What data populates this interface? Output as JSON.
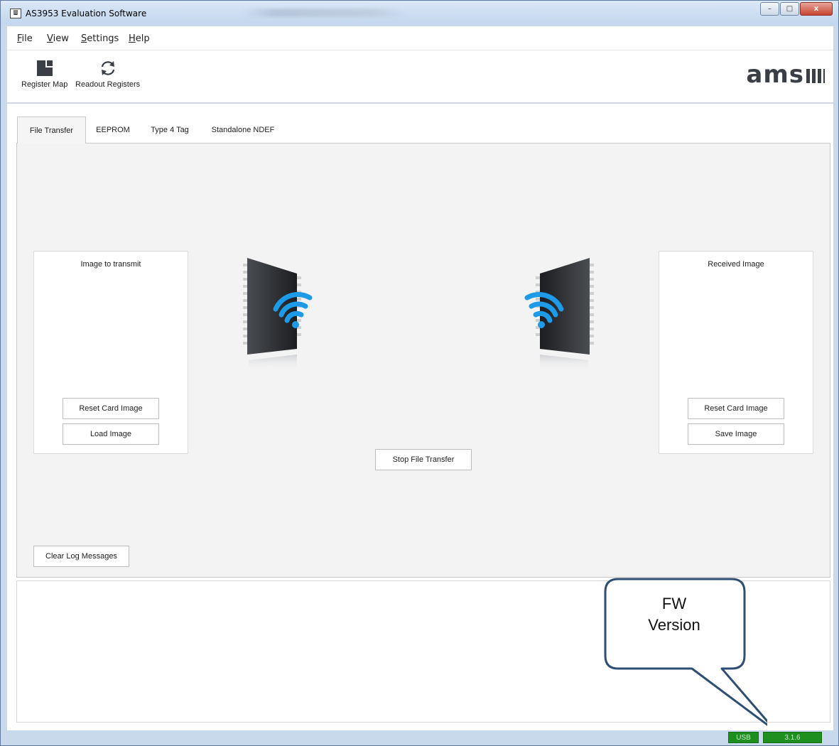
{
  "window": {
    "title": "AS3953 Evaluation Software",
    "app_icon": "ams-icon",
    "controls": {
      "minimize": "–",
      "maximize": "□",
      "close": "x"
    }
  },
  "menu": {
    "items": [
      {
        "label": "File"
      },
      {
        "label": "View"
      },
      {
        "label": "Settings"
      },
      {
        "label": "Help"
      }
    ]
  },
  "toolbar": {
    "register_map_label": "Register Map",
    "register_map_icon": "register-map-icon",
    "readout_registers_label": "Readout Registers",
    "readout_registers_icon": "refresh-icon",
    "logo_text": "ams"
  },
  "tabs": [
    {
      "label": "File Transfer",
      "active": true
    },
    {
      "label": "EEPROM",
      "active": false
    },
    {
      "label": "Type 4 Tag",
      "active": false
    },
    {
      "label": "Standalone NDEF",
      "active": false
    }
  ],
  "file_transfer": {
    "left_panel": {
      "title": "Image to transmit",
      "reset_label": "Reset Card Image",
      "load_label": "Load Image"
    },
    "right_panel": {
      "title": "Received Image",
      "reset_label": "Reset Card Image",
      "save_label": "Save Image"
    },
    "stop_label": "Stop File Transfer",
    "clear_log_label": "Clear Log Messages"
  },
  "status": {
    "connection": "USB",
    "fw_version": "3.1.6",
    "status_color": "#1e8f1e"
  },
  "annotation": {
    "callout_line1": "FW",
    "callout_line2": "Version",
    "callout_color": "#2e4e74"
  }
}
